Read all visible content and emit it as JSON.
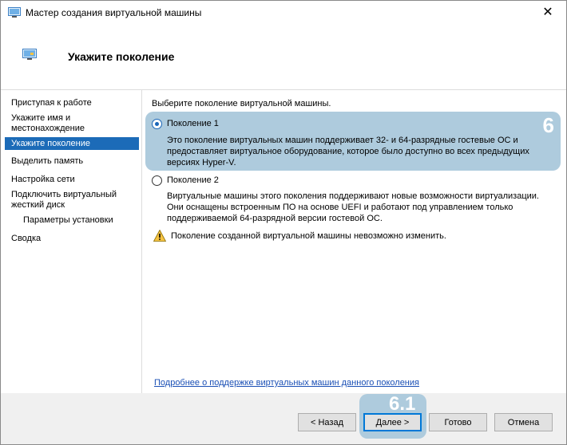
{
  "window": {
    "title": "Мастер создания виртуальной машины",
    "close_glyph": "✕"
  },
  "header": {
    "title": "Укажите поколение"
  },
  "sidebar": {
    "items": [
      {
        "label": "Приступая к работе"
      },
      {
        "label": "Укажите имя и местонахождение"
      },
      {
        "label": "Укажите поколение",
        "selected": true
      },
      {
        "label": "Выделить память"
      },
      {
        "label": "Настройка сети"
      },
      {
        "label": "Подключить виртуальный жесткий диск"
      },
      {
        "label": "Параметры установки",
        "sub": true
      },
      {
        "label": "Сводка"
      }
    ]
  },
  "content": {
    "prompt": "Выберите поколение виртуальной машины.",
    "highlight_number": "6",
    "options": [
      {
        "label": "Поколение 1",
        "selected": true,
        "description": "Это поколение виртуальных машин поддерживает 32- и 64-разрядные гостевые ОС и предоставляет виртуальное оборудование, которое было доступно во всех предыдущих версиях Hyper-V."
      },
      {
        "label": "Поколение 2",
        "selected": false,
        "description": "Виртуальные машины этого поколения поддерживают новые возможности виртуализации. Они оснащены встроенным ПО на основе UEFI и работают под управлением только поддерживаемой 64-разрядной версии гостевой ОС."
      }
    ],
    "warning": "Поколение созданной виртуальной машины невозможно изменить.",
    "link": "Подробнее о поддержке виртуальных машин данного поколения"
  },
  "footer": {
    "highlight_number": "6.1",
    "back_label": "< Назад",
    "next_label": "Далее >",
    "finish_label": "Готово",
    "cancel_label": "Отмена"
  },
  "colors": {
    "accent": "#1c6bb8",
    "highlight": "#aecbdd",
    "link": "#1a4fb5"
  },
  "icons": [
    "window-app-icon",
    "close-icon",
    "wizard-header-icon",
    "warning-icon"
  ]
}
